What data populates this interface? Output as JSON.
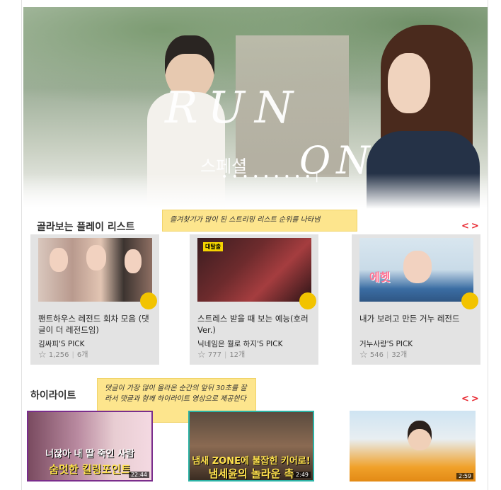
{
  "hero": {
    "title_main": "RUN",
    "title_sub": "스페셜",
    "title_end": "ON",
    "indicator": "• • • •  • • • • •  |"
  },
  "playlist": {
    "section_title": "골라보는 플레이 리스트",
    "tooltip": "즐겨찾기가 많이 된 스트리밍 리스트 순위를 나타냄",
    "prev_arrow": "<",
    "next_arrow": ">",
    "cards": [
      {
        "title": "팬트하우스 레전드 회차 모음 (댓글이 더 레전드임)",
        "owner": "김싸피'S PICK",
        "favorites": "1,256",
        "count": "6개"
      },
      {
        "title": "스트레스 받을 때 보는 예능(호러Ver.)",
        "owner": "닉네임은 뭘로 하지'S PICK",
        "favorites": "777",
        "count": "12개",
        "thumb_tag": "대탈출"
      },
      {
        "title": "내가 보려고 만든 거누 레전드",
        "owner": "거누사랑'S PICK",
        "favorites": "546",
        "count": "32개",
        "thumb_caption": "에헷"
      }
    ]
  },
  "highlights": {
    "section_title": "하이라이트",
    "tooltip": "댓글이 가장 많이 올라온 순간의 앞뒤 30초를 잘라서 댓글과 함께 하이라이트 영상으로 제공한다",
    "prev_arrow": "<",
    "next_arrow": ">",
    "items": [
      {
        "caption_top": "너잖아 내 딸 죽인 사람",
        "caption_bottom": "숨멋한 킬링포인트",
        "duration": "22:44"
      },
      {
        "caption_top": "냄새 ZONE에 불잡힌 키어로!",
        "caption_bottom": "냄세윤의 놀라운 촉",
        "duration": "2:49"
      },
      {
        "caption_top": "",
        "caption_bottom": "",
        "duration": "2:59"
      }
    ]
  },
  "star_icon": "☆",
  "colors": {
    "accent": "#e8262f",
    "tooltip": "#fde58d",
    "coin": "#f2c300",
    "card_bg": "#e3e3e3"
  }
}
